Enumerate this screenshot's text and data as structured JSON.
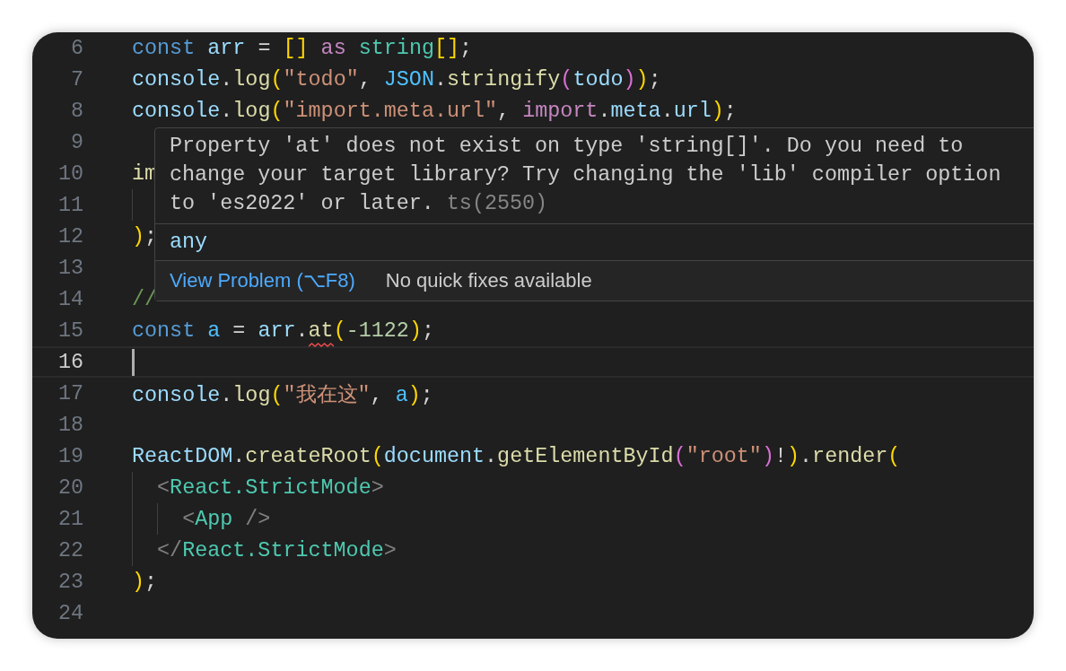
{
  "lines": [
    {
      "number": "6",
      "current": false,
      "tokens": [
        {
          "kind": "keyword",
          "text": "const "
        },
        {
          "kind": "variable",
          "text": "arr"
        },
        {
          "kind": "punct",
          "text": " = "
        },
        {
          "kind": "bracket",
          "text": "[] "
        },
        {
          "kind": "control",
          "text": "as "
        },
        {
          "kind": "type",
          "text": "string"
        },
        {
          "kind": "bracket",
          "text": "[]"
        },
        {
          "kind": "punct",
          "text": ";"
        }
      ]
    },
    {
      "number": "7",
      "current": false,
      "tokens": [
        {
          "kind": "variable",
          "text": "console"
        },
        {
          "kind": "punct",
          "text": "."
        },
        {
          "kind": "function",
          "text": "log"
        },
        {
          "kind": "bracket",
          "text": "("
        },
        {
          "kind": "string",
          "text": "\"todo\""
        },
        {
          "kind": "punct",
          "text": ", "
        },
        {
          "kind": "constant",
          "text": "JSON"
        },
        {
          "kind": "punct",
          "text": "."
        },
        {
          "kind": "function",
          "text": "stringify"
        },
        {
          "kind": "bracket-nested",
          "text": "("
        },
        {
          "kind": "variable",
          "text": "todo"
        },
        {
          "kind": "bracket-nested",
          "text": ")"
        },
        {
          "kind": "bracket",
          "text": ")"
        },
        {
          "kind": "punct",
          "text": ";"
        }
      ]
    },
    {
      "number": "8",
      "current": false,
      "tokens": [
        {
          "kind": "variable",
          "text": "console"
        },
        {
          "kind": "punct",
          "text": "."
        },
        {
          "kind": "function",
          "text": "log"
        },
        {
          "kind": "bracket",
          "text": "("
        },
        {
          "kind": "string",
          "text": "\"import.meta.url\""
        },
        {
          "kind": "punct",
          "text": ", "
        },
        {
          "kind": "control",
          "text": "import"
        },
        {
          "kind": "punct",
          "text": "."
        },
        {
          "kind": "variable",
          "text": "meta"
        },
        {
          "kind": "punct",
          "text": "."
        },
        {
          "kind": "variable",
          "text": "url"
        },
        {
          "kind": "bracket",
          "text": ")"
        },
        {
          "kind": "punct",
          "text": ";"
        }
      ]
    },
    {
      "number": "9",
      "current": false
    },
    {
      "number": "10",
      "current": false,
      "tokens": [
        {
          "kind": "function",
          "text": "im"
        }
      ]
    },
    {
      "number": "11",
      "current": false,
      "guides": [
        {
          "kind": "guide"
        }
      ]
    },
    {
      "number": "12",
      "current": false,
      "tokens": [
        {
          "kind": "bracket",
          "text": ")"
        },
        {
          "kind": "punct",
          "text": ";"
        }
      ]
    },
    {
      "number": "13",
      "current": false
    },
    {
      "number": "14",
      "current": false,
      "tokens": [
        {
          "kind": "comment",
          "text": "//"
        }
      ]
    },
    {
      "number": "15",
      "current": false,
      "tokens": [
        {
          "kind": "keyword",
          "text": "const "
        },
        {
          "kind": "constant",
          "text": "a"
        },
        {
          "kind": "punct",
          "text": " = "
        },
        {
          "kind": "variable",
          "text": "arr"
        },
        {
          "kind": "punct",
          "text": "."
        },
        {
          "kind": "function",
          "text": "at",
          "error": true
        },
        {
          "kind": "bracket",
          "text": "("
        },
        {
          "kind": "number",
          "text": "-1122"
        },
        {
          "kind": "bracket",
          "text": ")"
        },
        {
          "kind": "punct",
          "text": ";"
        }
      ]
    },
    {
      "number": "16",
      "current": true
    },
    {
      "number": "17",
      "current": false,
      "tokens": [
        {
          "kind": "variable",
          "text": "console"
        },
        {
          "kind": "punct",
          "text": "."
        },
        {
          "kind": "function",
          "text": "log"
        },
        {
          "kind": "bracket",
          "text": "("
        },
        {
          "kind": "string",
          "text": "\"我在这\""
        },
        {
          "kind": "punct",
          "text": ", "
        },
        {
          "kind": "constant",
          "text": "a"
        },
        {
          "kind": "bracket",
          "text": ")"
        },
        {
          "kind": "punct",
          "text": ";"
        }
      ]
    },
    {
      "number": "18",
      "current": false
    },
    {
      "number": "19",
      "current": false,
      "tokens": [
        {
          "kind": "variable",
          "text": "ReactDOM"
        },
        {
          "kind": "punct",
          "text": "."
        },
        {
          "kind": "function",
          "text": "createRoot"
        },
        {
          "kind": "bracket",
          "text": "("
        },
        {
          "kind": "variable",
          "text": "document"
        },
        {
          "kind": "punct",
          "text": "."
        },
        {
          "kind": "function",
          "text": "getElementById"
        },
        {
          "kind": "bracket-nested",
          "text": "("
        },
        {
          "kind": "string",
          "text": "\"root\""
        },
        {
          "kind": "bracket-nested",
          "text": ")"
        },
        {
          "kind": "punct",
          "text": "!"
        },
        {
          "kind": "bracket",
          "text": ")"
        },
        {
          "kind": "punct",
          "text": "."
        },
        {
          "kind": "function",
          "text": "render"
        },
        {
          "kind": "bracket",
          "text": "("
        }
      ]
    },
    {
      "number": "20",
      "current": false,
      "guides": [
        {
          "kind": "guide"
        }
      ],
      "tokens": [
        {
          "kind": "tag-punct",
          "text": "<"
        },
        {
          "kind": "type",
          "text": "React.StrictMode"
        },
        {
          "kind": "tag-punct",
          "text": ">"
        }
      ]
    },
    {
      "number": "21",
      "current": false,
      "guides": [
        {
          "kind": "guide"
        },
        {
          "kind": "guide"
        }
      ],
      "tokens": [
        {
          "kind": "tag-punct",
          "text": "<"
        },
        {
          "kind": "type",
          "text": "App"
        },
        {
          "kind": "tag-punct",
          "text": " />"
        }
      ]
    },
    {
      "number": "22",
      "current": false,
      "guides": [
        {
          "kind": "guide"
        }
      ],
      "tokens": [
        {
          "kind": "tag-punct",
          "text": "</"
        },
        {
          "kind": "type",
          "text": "React.StrictMode"
        },
        {
          "kind": "tag-punct",
          "text": ">"
        }
      ]
    },
    {
      "number": "23",
      "current": false,
      "tokens": [
        {
          "kind": "bracket",
          "text": ")"
        },
        {
          "kind": "punct",
          "text": ";"
        }
      ]
    },
    {
      "number": "24",
      "current": false
    }
  ],
  "hover": {
    "message": "Property 'at' does not exist on type 'string[]'. Do you need to change your target library? Try changing the 'lib' compiler option to 'es2022' or later.",
    "code": "ts(2550)",
    "type": "any",
    "link": "View Problem (⌥F8)",
    "note": "No quick fixes available"
  }
}
